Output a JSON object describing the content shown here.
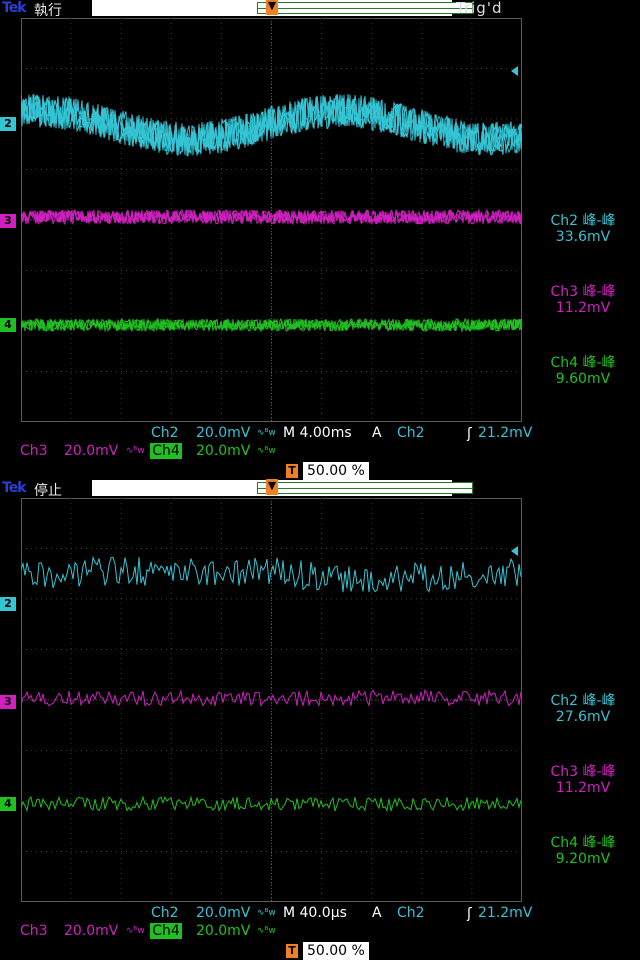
{
  "panels": [
    {
      "id": "top",
      "brand": "Tek",
      "state": "執行",
      "trig_status": "Trig'd",
      "trigger_marker": "T",
      "channel_markers": [
        "2",
        "3",
        "4"
      ],
      "measurements": [
        {
          "label": "Ch2 峰-峰",
          "value": "33.6mV"
        },
        {
          "label": "Ch3 峰-峰",
          "value": "11.2mV"
        },
        {
          "label": "Ch4 峰-峰",
          "value": "9.60mV"
        }
      ],
      "bottom": {
        "ch2_label": "Ch2",
        "ch2_scale": "20.0mV",
        "bw_symbol": "∿ᴮw",
        "timebase": "M 4.00ms",
        "trig_mode": "A",
        "trig_source": "Ch2",
        "trig_slope": "ʃ",
        "trig_level": "21.2mV",
        "ch3_label": "Ch3",
        "ch3_scale": "20.0mV",
        "ch4_label": "Ch4",
        "ch4_scale": "20.0mV",
        "trig_pos_marker": "T",
        "trig_pos": "50.00 %"
      }
    },
    {
      "id": "bottom",
      "brand": "Tek",
      "state": "停止",
      "trig_status": "",
      "trigger_marker": "T",
      "channel_markers": [
        "2",
        "3",
        "4"
      ],
      "measurements": [
        {
          "label": "Ch2 峰-峰",
          "value": "27.6mV"
        },
        {
          "label": "Ch3 峰-峰",
          "value": "11.2mV"
        },
        {
          "label": "Ch4 峰-峰",
          "value": "9.20mV"
        }
      ],
      "bottom": {
        "ch2_label": "Ch2",
        "ch2_scale": "20.0mV",
        "bw_symbol": "∿ᴮw",
        "timebase": "M 40.0µs",
        "trig_mode": "A",
        "trig_source": "Ch2",
        "trig_slope": "ʃ",
        "trig_level": "21.2mV",
        "ch3_label": "Ch3",
        "ch3_scale": "20.0mV",
        "ch4_label": "Ch4",
        "ch4_scale": "20.0mV",
        "trig_pos_marker": "T",
        "trig_pos": "50.00 %"
      }
    }
  ],
  "colors": {
    "ch2": "#35c4d4",
    "ch3": "#d020c0",
    "ch4": "#20c020",
    "trigger": "#f08020",
    "grid": "#3a3a3a",
    "brand": "#2a3fd6"
  }
}
